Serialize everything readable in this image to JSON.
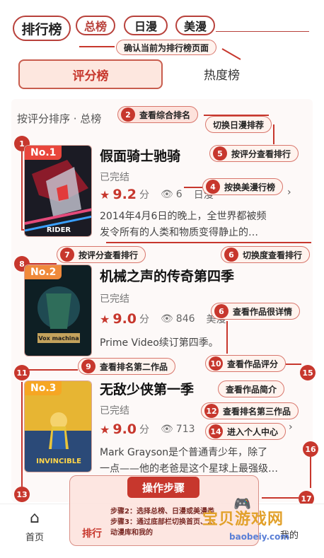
{
  "header": {
    "main_tab": "排行榜",
    "sub_tabs": [
      "总榜",
      "日漫",
      "美漫"
    ]
  },
  "segments": {
    "left": "评分榜",
    "right": "热度榜"
  },
  "sort_label": "按评分排序 · 总榜",
  "items": [
    {
      "rank": "No.1",
      "title": "假面骑士驰骑",
      "status": "已完结",
      "score": "9.2",
      "score_unit": "分",
      "views": "6",
      "region": "日漫",
      "desc_line1": "2014年4月6日的晚上，全世界都被频",
      "desc_line2": "发令所有的人类和物质变得静止的…"
    },
    {
      "rank": "No.2",
      "title": "机械之声的传奇第四季",
      "status": "已完结",
      "score": "9.0",
      "score_unit": "分",
      "views": "846",
      "region": "美漫",
      "desc_line1": "Prime Video续订第四季。",
      "desc_line2": ""
    },
    {
      "rank": "No.3",
      "title": "无敌少侠第一季",
      "status": "已完结",
      "score": "9.0",
      "score_unit": "分",
      "views": "713",
      "region": "美漫",
      "desc_line1": "Mark Grayson是个普通青少年，除了",
      "desc_line2": "一点——他的老爸是这个星球上最强级…"
    }
  ],
  "covers": {
    "c1": "RIDER",
    "c2": "Vox machina",
    "c3": "INVINCIBLE"
  },
  "annotations": {
    "confirm": "确认当前为排行榜页面",
    "a2": "查看综合排名",
    "switch_riman": "切换日漫排荐",
    "a5": "按评分查看排行",
    "a4": "按换美漫行榜",
    "a7": "按评分查看排行",
    "a6a": "切换度查看排行",
    "a6b": "查看作品很详情",
    "a9": "查看排名第二作品",
    "a10": "查看作品评分",
    "intro": "查看作品简介",
    "a12": "查看排名第三作品",
    "a14": "进入个人中心",
    "n1": "1",
    "n2": "2",
    "n4": "4",
    "n5": "5",
    "n6": "6",
    "n7": "7",
    "n8": "8",
    "n9": "9",
    "n10": "10",
    "n11": "11",
    "n12": "12",
    "n13": "13",
    "n14": "14",
    "n15": "15",
    "n16": "16",
    "n17": "17"
  },
  "bottom_nav": {
    "home": "首页",
    "me": "我的"
  },
  "steps": {
    "title": "操作步骤",
    "tab_label": "排行",
    "step2": "步骤2：选择总榜、日漫或美漫类",
    "step3": "步骤3：通过底部栏切换首页、...",
    "step3b": "动漫库和我的"
  },
  "watermark": {
    "big": "宝贝游戏网",
    "small": "baobeiy.com"
  },
  "colors": {
    "accent": "#c7372d",
    "badge1": "#e9463c",
    "badge2": "#f08a3c",
    "badge3": "#f6a623"
  },
  "icons": [
    "star-icon",
    "eye-icon",
    "home-icon",
    "chevron-right-icon",
    "gamepad-icon"
  ]
}
